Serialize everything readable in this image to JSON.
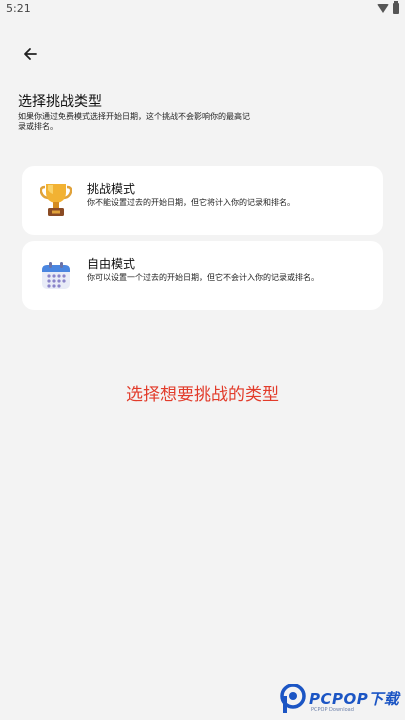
{
  "status_bar": {
    "time": "5:21"
  },
  "header": {
    "back_icon": "arrow-left-icon",
    "title": "选择挑战类型",
    "subtitle": "如果你通过免费模式选择开始日期，这个挑战不会影响你的最高记录或排名。"
  },
  "modes": [
    {
      "icon": "trophy-icon",
      "title": "挑战模式",
      "description": "你不能设置过去的开始日期，但它将计入你的记录和排名。"
    },
    {
      "icon": "calendar-icon",
      "title": "自由模式",
      "description": "你可以设置一个过去的开始日期，但它不会计入你的记录或排名。"
    }
  ],
  "hint_text": "选择想要挑战的类型",
  "watermark": {
    "text": "PCPOP下载",
    "sub": "PCPOP Download"
  },
  "colors": {
    "background": "#f3f3f3",
    "card": "#ffffff",
    "hint": "#e23b2a",
    "watermark": "#1b55c4"
  }
}
